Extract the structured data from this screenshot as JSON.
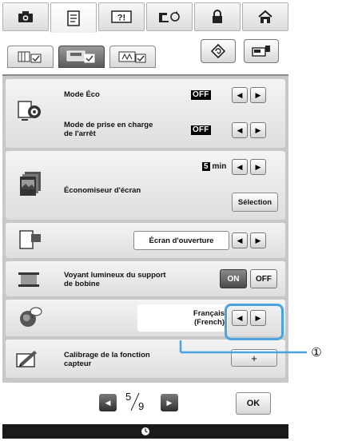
{
  "top_tabs": [
    {
      "icon": "camera-icon",
      "active": false
    },
    {
      "icon": "document-icon",
      "active": true
    },
    {
      "icon": "help-question-icon",
      "active": false
    },
    {
      "icon": "sewing-machine-icon",
      "active": false
    },
    {
      "icon": "lock-icon",
      "active": false
    },
    {
      "icon": "house-icon",
      "active": false
    }
  ],
  "sub_tabs": [
    {
      "icon": "settings-page1-icon",
      "active": false
    },
    {
      "icon": "settings-page2-icon",
      "active": true
    },
    {
      "icon": "settings-page3-icon",
      "active": false
    }
  ],
  "settings": {
    "eco_mode": {
      "label": "Mode Éco",
      "value": "OFF"
    },
    "shutoff_support": {
      "label": "Mode de prise en charge de l'arrêt",
      "value": "OFF"
    },
    "screen_saver": {
      "label": "Économiseur d'écran",
      "time_value": "5",
      "time_unit": "min",
      "select_label": "Sélection"
    },
    "opening_screen": {
      "value": "Écran d'ouverture"
    },
    "bobbin_light": {
      "label": "Voyant lumineux du support de bobine",
      "on_label": "ON",
      "off_label": "OFF",
      "selected": "ON"
    },
    "language": {
      "value_line1": "Français",
      "value_line2": "(French)"
    },
    "sensor_calibration": {
      "label": "Calibrage de la fonction capteur",
      "button_label": "+"
    }
  },
  "pagination": {
    "current": "5",
    "total": "9"
  },
  "ok_label": "OK",
  "callout": {
    "number": "①"
  },
  "arrow_left": "◀",
  "arrow_right": "▶",
  "colors": {
    "highlight": "#4aa3e0",
    "panel_bg": "#c8c8c8",
    "footer_bg": "#1a1a1a"
  }
}
